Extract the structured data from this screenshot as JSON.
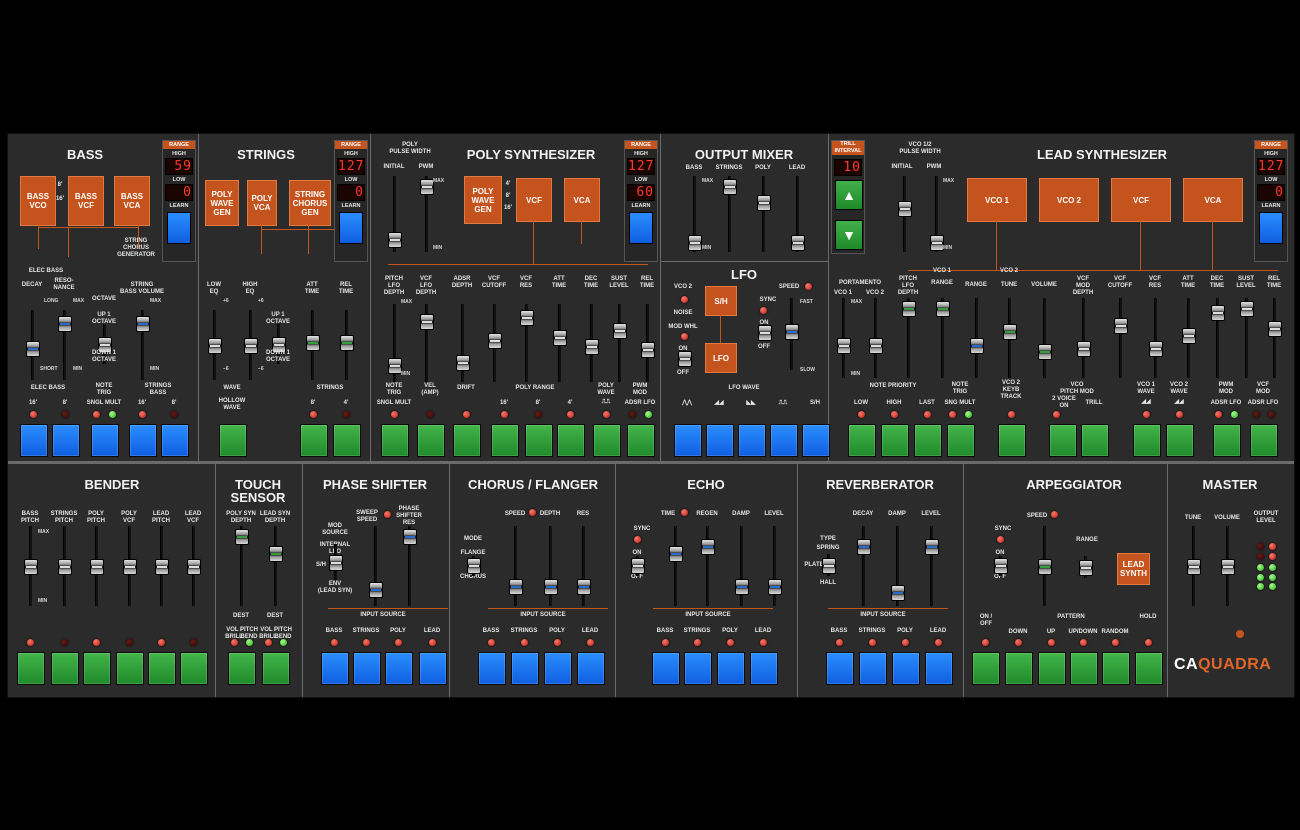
{
  "top_sections": {
    "bass": {
      "title": "BASS",
      "boxes": [
        "BASS\nVCO",
        "BASS\nVCF",
        "BASS\nVCA"
      ],
      "oct_labels": [
        "8'",
        "16'"
      ],
      "string_chorus": "STRING\nCHORUS\nGENERATOR",
      "knobs": [
        "ELEC BASS",
        "DECAY",
        "RESO-\nNANCE",
        "OCTAVE",
        "STRING\nBASS VOLUME"
      ],
      "marks": {
        "long": "LONG",
        "short": "SHORT",
        "max": "MAX",
        "min": "MIN",
        "up1": "UP 1\nOCTAVE",
        "down1": "DOWN 1\nOCTAVE"
      },
      "group_labels": [
        "ELEC BASS",
        "NOTE\nTRIG",
        "STRINGS\nBASS"
      ],
      "button_labels": [
        "16'",
        "8'",
        "SNGL MULT",
        "",
        "16'",
        "8'"
      ]
    },
    "strings": {
      "title": "STRINGS",
      "boxes": [
        "POLY\nWAVE\nGEN",
        "POLY\nVCA",
        "STRING\nCHORUS\nGEN"
      ],
      "knobs": [
        "LOW\nEQ",
        "HIGH\nEQ",
        "ATT\nTIME",
        "REL\nTIME"
      ],
      "marks": {
        "plus6": "+6",
        "minus6": "−6",
        "up1": "UP 1\nOCTAVE",
        "down1": "DOWN 1\nOCTAVE"
      },
      "group_labels": [
        "WAVE",
        "STRINGS"
      ],
      "button_labels": [
        "HOLLOW\nWAVE",
        "8'",
        "4'"
      ]
    },
    "poly": {
      "title": "POLY SYNTHESIZER",
      "pw_title": "POLY\nPULSE WIDTH",
      "pw_labels": [
        "INITIAL",
        "PWM"
      ],
      "boxes": [
        "POLY\nWAVE\nGEN",
        "VCF",
        "VCA"
      ],
      "oct_labels": [
        "4'",
        "8'",
        "16'"
      ],
      "knobs": [
        "PITCH\nLFO\nDEPTH",
        "VCF\nLFO\nDEPTH",
        "ADSR\nDEPTH",
        "VCF\nCUTOFF",
        "VCF\nRES",
        "ATT\nTIME",
        "DEC\nTIME",
        "SUST\nLEVEL",
        "REL\nTIME"
      ],
      "group_labels": [
        "NOTE\nTRIG",
        "VEL\n(AMP)",
        "DRIFT",
        "POLY RANGE",
        "POLY\nWAVE",
        "PWM\nMOD"
      ],
      "button_labels": [
        "SNGL MULT",
        "",
        "",
        "16'",
        "8'",
        "4'",
        "⎍⎍",
        "ADSR LFO"
      ]
    },
    "mixer": {
      "title": "OUTPUT MIXER",
      "channels": [
        "BASS",
        "STRINGS",
        "POLY",
        "LEAD"
      ]
    },
    "lfo": {
      "title": "LFO",
      "sources": [
        "VCO 2",
        "NOISE",
        "MOD WHL",
        "ON",
        "OFF"
      ],
      "sh": "S/H",
      "lfo": "LFO",
      "sync": "SYNC",
      "speed": "SPEED",
      "fast": "FAST",
      "slow": "SLOW",
      "on": "ON",
      "off": "OFF",
      "wave_label": "LFO WAVE",
      "waves": [
        "⋀⋀",
        "◢◢",
        "◣◣",
        "⎍⎍",
        "S/H"
      ]
    },
    "lead": {
      "title": "LEAD SYNTHESIZER",
      "trill": "TRILL\nINTERVAL",
      "trill_value": "10",
      "pw_title": "VCO 1/2\nPULSE WIDTH",
      "pw_labels": [
        "INITIAL",
        "PWM"
      ],
      "boxes": [
        "VCO 1",
        "VCO 2",
        "VCF",
        "VCA"
      ],
      "knobs": [
        "PORTAMENTO",
        "PITCH\nLFO\nDEPTH",
        "RANGE",
        "RANGE",
        "TUNE",
        "VOLUME",
        "VCF\nMOD\nDEPTH",
        "VCF\nCUTOFF",
        "VCF\nRES",
        "ATT\nTIME",
        "DEC\nTIME",
        "SUST\nLEVEL",
        "REL\nTIME"
      ],
      "sub": [
        "VCO 1",
        "VCO 2",
        "VCO 1",
        "VCO 2"
      ],
      "group_labels": [
        "NOTE PRIORITY",
        "NOTE\nTRIG",
        "VCO 2\nKEYB\nTRACK",
        "VCO\nPITCH MOD",
        "VCO 1\nWAVE",
        "VCO 2\nWAVE",
        "PWM\nMOD",
        "VCF\nMOD"
      ],
      "button_labels": [
        "LOW",
        "HIGH",
        "LAST",
        "SNG MULT",
        "",
        "2 VOICE\nON",
        "TRILL",
        "◢◢",
        "◢◢",
        "ADSR LFO",
        "ADSR LFO"
      ]
    }
  },
  "ranges": [
    {
      "header": "RANGE",
      "high": "HIGH",
      "high_val": "59",
      "low": "LOW",
      "low_val": "0",
      "learn": "LEARN"
    },
    {
      "header": "RANGE",
      "high": "HIGH",
      "high_val": "127",
      "low": "LOW",
      "low_val": "0",
      "learn": "LEARN"
    },
    {
      "header": "RANGE",
      "high": "HIGH",
      "high_val": "127",
      "low": "LOW",
      "low_val": "60",
      "learn": "LEARN"
    },
    {
      "header": "RANGE",
      "high": "HIGH",
      "high_val": "127",
      "low": "LOW",
      "low_val": "0",
      "learn": "LEARN"
    }
  ],
  "bottom_sections": {
    "bender": {
      "title": "BENDER",
      "knobs": [
        "BASS\nPITCH",
        "STRINGS\nPITCH",
        "POLY\nPITCH",
        "POLY\nVCF",
        "LEAD\nPITCH",
        "LEAD\nVCF"
      ]
    },
    "touch": {
      "title": "TOUCH\nSENSOR",
      "knobs": [
        "POLY SYN\nDEPTH",
        "LEAD SYN\nDEPTH"
      ],
      "dest": "DEST",
      "dest_labels": [
        "VOL /\nBRILL",
        "PITCH\nBEND"
      ]
    },
    "phase": {
      "title": "PHASE SHIFTER",
      "labels": [
        "MOD\nSOURCE",
        "SWEEP\nSPEED",
        "PHASE\nSHIFTER\nRES",
        "INTERNAL\nLFO",
        "S/H",
        "ENV\n(LEAD SYN)"
      ],
      "input": "INPUT SOURCE"
    },
    "chorus": {
      "title": "CHORUS / FLANGER",
      "labels": [
        "MODE",
        "FLANGE",
        "CHORUS",
        "SPEED",
        "DEPTH",
        "RES"
      ],
      "input": "INPUT SOURCE"
    },
    "echo": {
      "title": "ECHO",
      "labels": [
        "SYNC",
        "ON",
        "OFF",
        "TIME",
        "REGEN",
        "DAMP",
        "LEVEL"
      ],
      "input": "INPUT SOURCE"
    },
    "reverb": {
      "title": "REVERBERATOR",
      "labels": [
        "TYPE",
        "SPRING",
        "PLATE",
        "HALL",
        "DECAY",
        "DAMP",
        "LEVEL"
      ],
      "input": "INPUT SOURCE"
    },
    "arp": {
      "title": "ARPEGGIATOR",
      "labels": [
        "SYNC",
        "ON",
        "OFF",
        "SPEED",
        "RANGE"
      ],
      "lead_synth": "LEAD\nSYNTH",
      "pattern": "PATTERN",
      "on_off": "ON /\nOFF",
      "hold": "HOLD",
      "patterns": [
        "DOWN",
        "UP",
        "UP/DOWN",
        "RANDOM"
      ]
    },
    "master": {
      "title": "MASTER",
      "labels": [
        "TUNE",
        "VOLUME",
        "OUTPUT\nLEVEL"
      ]
    }
  },
  "input_sources": [
    "BASS",
    "STRINGS",
    "POLY",
    "LEAD"
  ],
  "marks": {
    "max": "MAX",
    "min": "MIN",
    "high": "HIGH",
    "low": "LOW"
  },
  "logo": {
    "ca": "CA",
    "quadra": "QUADRA"
  },
  "colors": {
    "panel": "#2b2b2b",
    "accent": "#c4531e",
    "blue": "#1f74f0",
    "green": "#2f9e3a"
  }
}
